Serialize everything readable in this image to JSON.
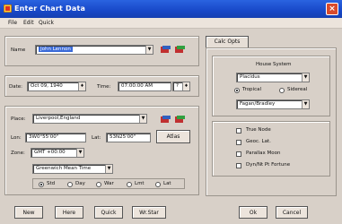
{
  "window": {
    "title": "Enter Chart Data",
    "close_glyph": "×"
  },
  "menu": [
    "File",
    "Edit",
    "Quick"
  ],
  "name_section": {
    "label": "Name",
    "value": "John Lennon"
  },
  "date_section": {
    "date_label": "Date:",
    "date_value": "Oct 09, 1940",
    "time_label": "Time:",
    "time_value": "07:00:00 AM",
    "time_flag": "?"
  },
  "place_section": {
    "place_label": "Place:",
    "place_value": "Liverpool,England",
    "lon_label": "Lon:",
    "lon_value": "3W0°55'00\"",
    "lat_label": "Lat:",
    "lat_value": "53N25'00\"",
    "atlas_label": "Atlas",
    "zone_label": "Zone:",
    "zone_value": "GMT +00:00",
    "timezone_value": "Greenwich Mean Time",
    "radios": [
      "Std",
      "Day",
      "War",
      "Lmt",
      "Lat"
    ],
    "radio_selected": 0
  },
  "buttons": [
    "New",
    "Here",
    "Quick",
    "Wr.Star",
    "Ok",
    "Cancel"
  ],
  "calc_opts": {
    "tab_label": "Calc Opts",
    "house_system_label": "House System",
    "house_system_value": "Placidus",
    "zodiac_options": [
      "Tropical",
      "Sidereal"
    ],
    "zodiac_selected": 0,
    "ayanamsa_value": "Fagan/Bradley",
    "checkboxes": [
      "True Node",
      "Geoc. Lat.",
      "Parallax Moon",
      "Dyn/Nt Pt Fortune"
    ]
  }
}
